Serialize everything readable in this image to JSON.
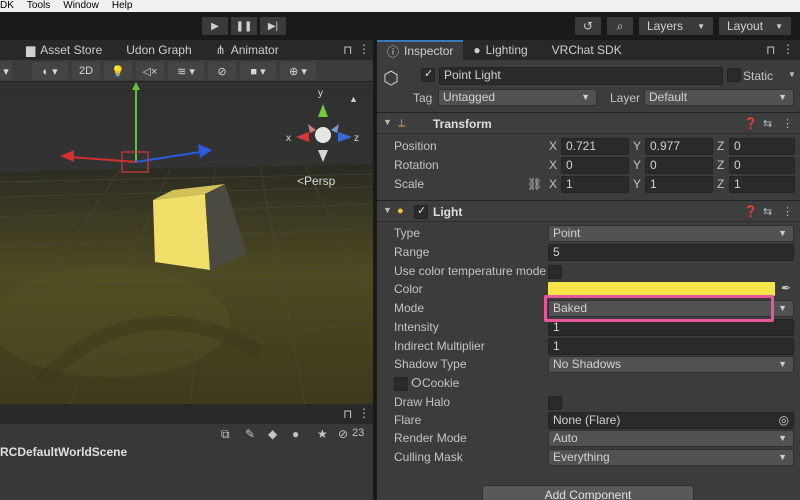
{
  "menubar": [
    "DK",
    "Tools",
    "Window",
    "Help"
  ],
  "toolbar": {
    "play_icon": "play-icon",
    "pause_icon": "pause-icon",
    "step_icon": "step-icon",
    "layers_label": "Layers",
    "layout_label": "Layout"
  },
  "left_tabs": {
    "asset_store": "Asset Store",
    "udon_graph": "Udon Graph",
    "animator": "Animator"
  },
  "scene_toolbar": {
    "mode_2d": "2D"
  },
  "scene": {
    "persp_label": "<Persp",
    "axis_y": "y",
    "axis_x": "x",
    "axis_z": "z"
  },
  "hierarchy": {
    "scene_name": "RCDefaultWorldScene",
    "count": "23"
  },
  "inspector_tabs": {
    "inspector": "Inspector",
    "lighting": "Lighting",
    "vrchat_sdk": "VRChat SDK"
  },
  "object": {
    "name": "Point Light",
    "static_label": "Static",
    "tag_label": "Tag",
    "tag_value": "Untagged",
    "layer_label": "Layer",
    "layer_value": "Default"
  },
  "transform": {
    "title": "Transform",
    "position_label": "Position",
    "rotation_label": "Rotation",
    "scale_label": "Scale",
    "position": {
      "x": "0.721",
      "y": "0.977",
      "z": "0"
    },
    "rotation": {
      "x": "0",
      "y": "0",
      "z": "0"
    },
    "scale": {
      "x": "1",
      "y": "1",
      "z": "1"
    }
  },
  "light": {
    "title": "Light",
    "type_label": "Type",
    "type_value": "Point",
    "range_label": "Range",
    "range_value": "5",
    "color_temp_label": "Use color temperature mode",
    "color_label": "Color",
    "color_value": "#f5e54b",
    "mode_label": "Mode",
    "mode_value": "Baked",
    "intensity_label": "Intensity",
    "intensity_value": "1",
    "indirect_label": "Indirect Multiplier",
    "indirect_value": "1",
    "shadow_label": "Shadow Type",
    "shadow_value": "No Shadows",
    "cookie_label": "Cookie",
    "halo_label": "Draw Halo",
    "flare_label": "Flare",
    "flare_value": "None (Flare)",
    "render_mode_label": "Render Mode",
    "render_mode_value": "Auto",
    "culling_label": "Culling Mask",
    "culling_value": "Everything"
  },
  "add_component": "Add Component",
  "accent": {
    "highlight": "#e7559b",
    "tab_active": "#3a79bb"
  }
}
